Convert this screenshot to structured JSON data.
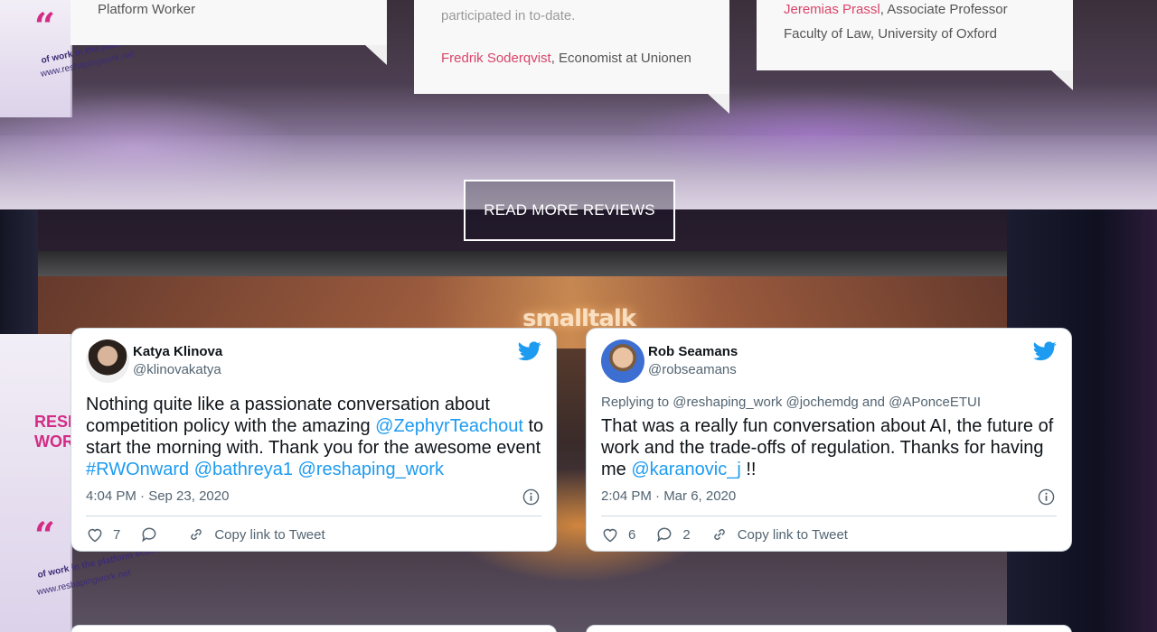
{
  "reviews": [
    {
      "line": "Platform Worker"
    },
    {
      "faded_line": "participated in to-date.",
      "author_name": "Fredrik Soderqvist",
      "author_role": ", Economist at Unionen"
    },
    {
      "author_name": "Jeremias Prassl",
      "author_role": ", Associate Professor",
      "author_role_line2": "Faculty of Law, University of Oxford"
    }
  ],
  "read_more": {
    "label": "READ MORE REVIEWS"
  },
  "background": {
    "sign_text": "smalltalk",
    "banner_brand": "“",
    "banner_tagline": "of work in the platform economy",
    "banner_url": "www.reshapingwork.net",
    "banner_word": "RESH WORK"
  },
  "tweets": [
    {
      "display_name": "Katya Klinova",
      "handle": "@klinovakatya",
      "body_parts": {
        "t1": "Nothing quite like a passionate conversation about competition policy with the amazing ",
        "l1": "@ZephyrTeachout",
        "t2": " to start the morning with. Thank you for the awesome event ",
        "l2": "#RWOnward",
        "t3": " ",
        "l3": "@bathreya1",
        "t4": " ",
        "l4": "@reshaping_work"
      },
      "time": "4:04 PM · Sep 23, 2020",
      "likes": "7",
      "copy_label": "Copy link to Tweet"
    },
    {
      "display_name": "Rob Seamans",
      "handle": "@robseamans",
      "reply_to": "Replying to @reshaping_work @jochemdg and @APonceETUI",
      "body_parts": {
        "t1": "That was a really fun conversation about AI, the future of work and the trade-offs of regulation. Thanks for having me ",
        "l1": "@karanovic_j",
        "t2": " !!"
      },
      "time": "2:04 PM · Mar 6, 2020",
      "likes": "6",
      "replies": "2",
      "copy_label": "Copy link to Tweet"
    }
  ],
  "colors": {
    "accent_pink": "#d9456a",
    "twitter_blue": "#1d9bf0",
    "muted_text": "#536471"
  },
  "icons": [
    "twitter-bird-icon",
    "info-icon",
    "heart-icon",
    "reply-bubble-icon",
    "link-icon"
  ]
}
